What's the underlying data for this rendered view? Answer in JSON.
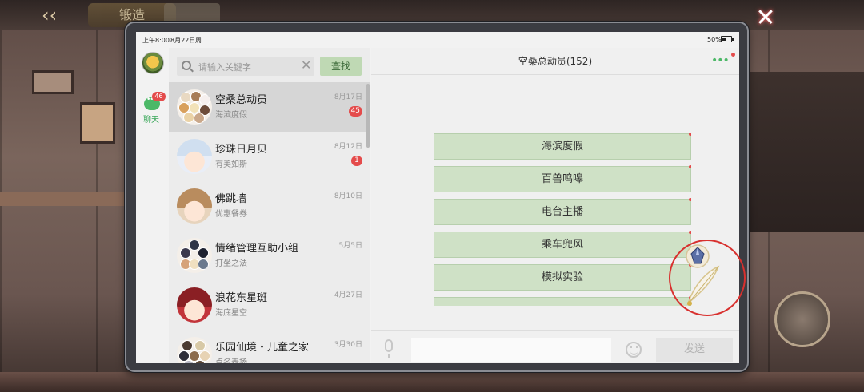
{
  "statusbar": {
    "time": "上午8:00",
    "date": "8月22日",
    "weekday": "周二",
    "battery": "50%"
  },
  "rail": {
    "chat_badge": "46",
    "chat_label": "聊天"
  },
  "search": {
    "placeholder": "请输入关键字",
    "button": "查找"
  },
  "conversations": [
    {
      "name": "空桑总动员",
      "preview": "海滨度假",
      "date": "8月17日",
      "badge": "45"
    },
    {
      "name": "珍珠日月贝",
      "preview": "有美如斯",
      "date": "8月12日",
      "badge": "1"
    },
    {
      "name": "佛跳墙",
      "preview": "优惠餐券",
      "date": "8月10日",
      "badge": ""
    },
    {
      "name": "情绪管理互助小组",
      "preview": "打坐之法",
      "date": "5月5日",
      "badge": ""
    },
    {
      "name": "浪花东星斑",
      "preview": "海底星空",
      "date": "4月27日",
      "badge": ""
    },
    {
      "name": "乐园仙境・儿童之家",
      "preview": "点名表扬",
      "date": "3月30日",
      "badge": ""
    }
  ],
  "chat": {
    "title": "空桑总动员(152)",
    "options": [
      "海滨度假",
      "百兽鸣嗥",
      "电台主播",
      "乘车兜风",
      "模拟实验"
    ],
    "send": "发送"
  },
  "background": {
    "title_tab": "锻造"
  },
  "colors": {
    "accent_green": "#4cb867",
    "badge_red": "#e44b4b",
    "option_bg": "#cfe1c6",
    "highlight_circle": "#d8302e"
  }
}
